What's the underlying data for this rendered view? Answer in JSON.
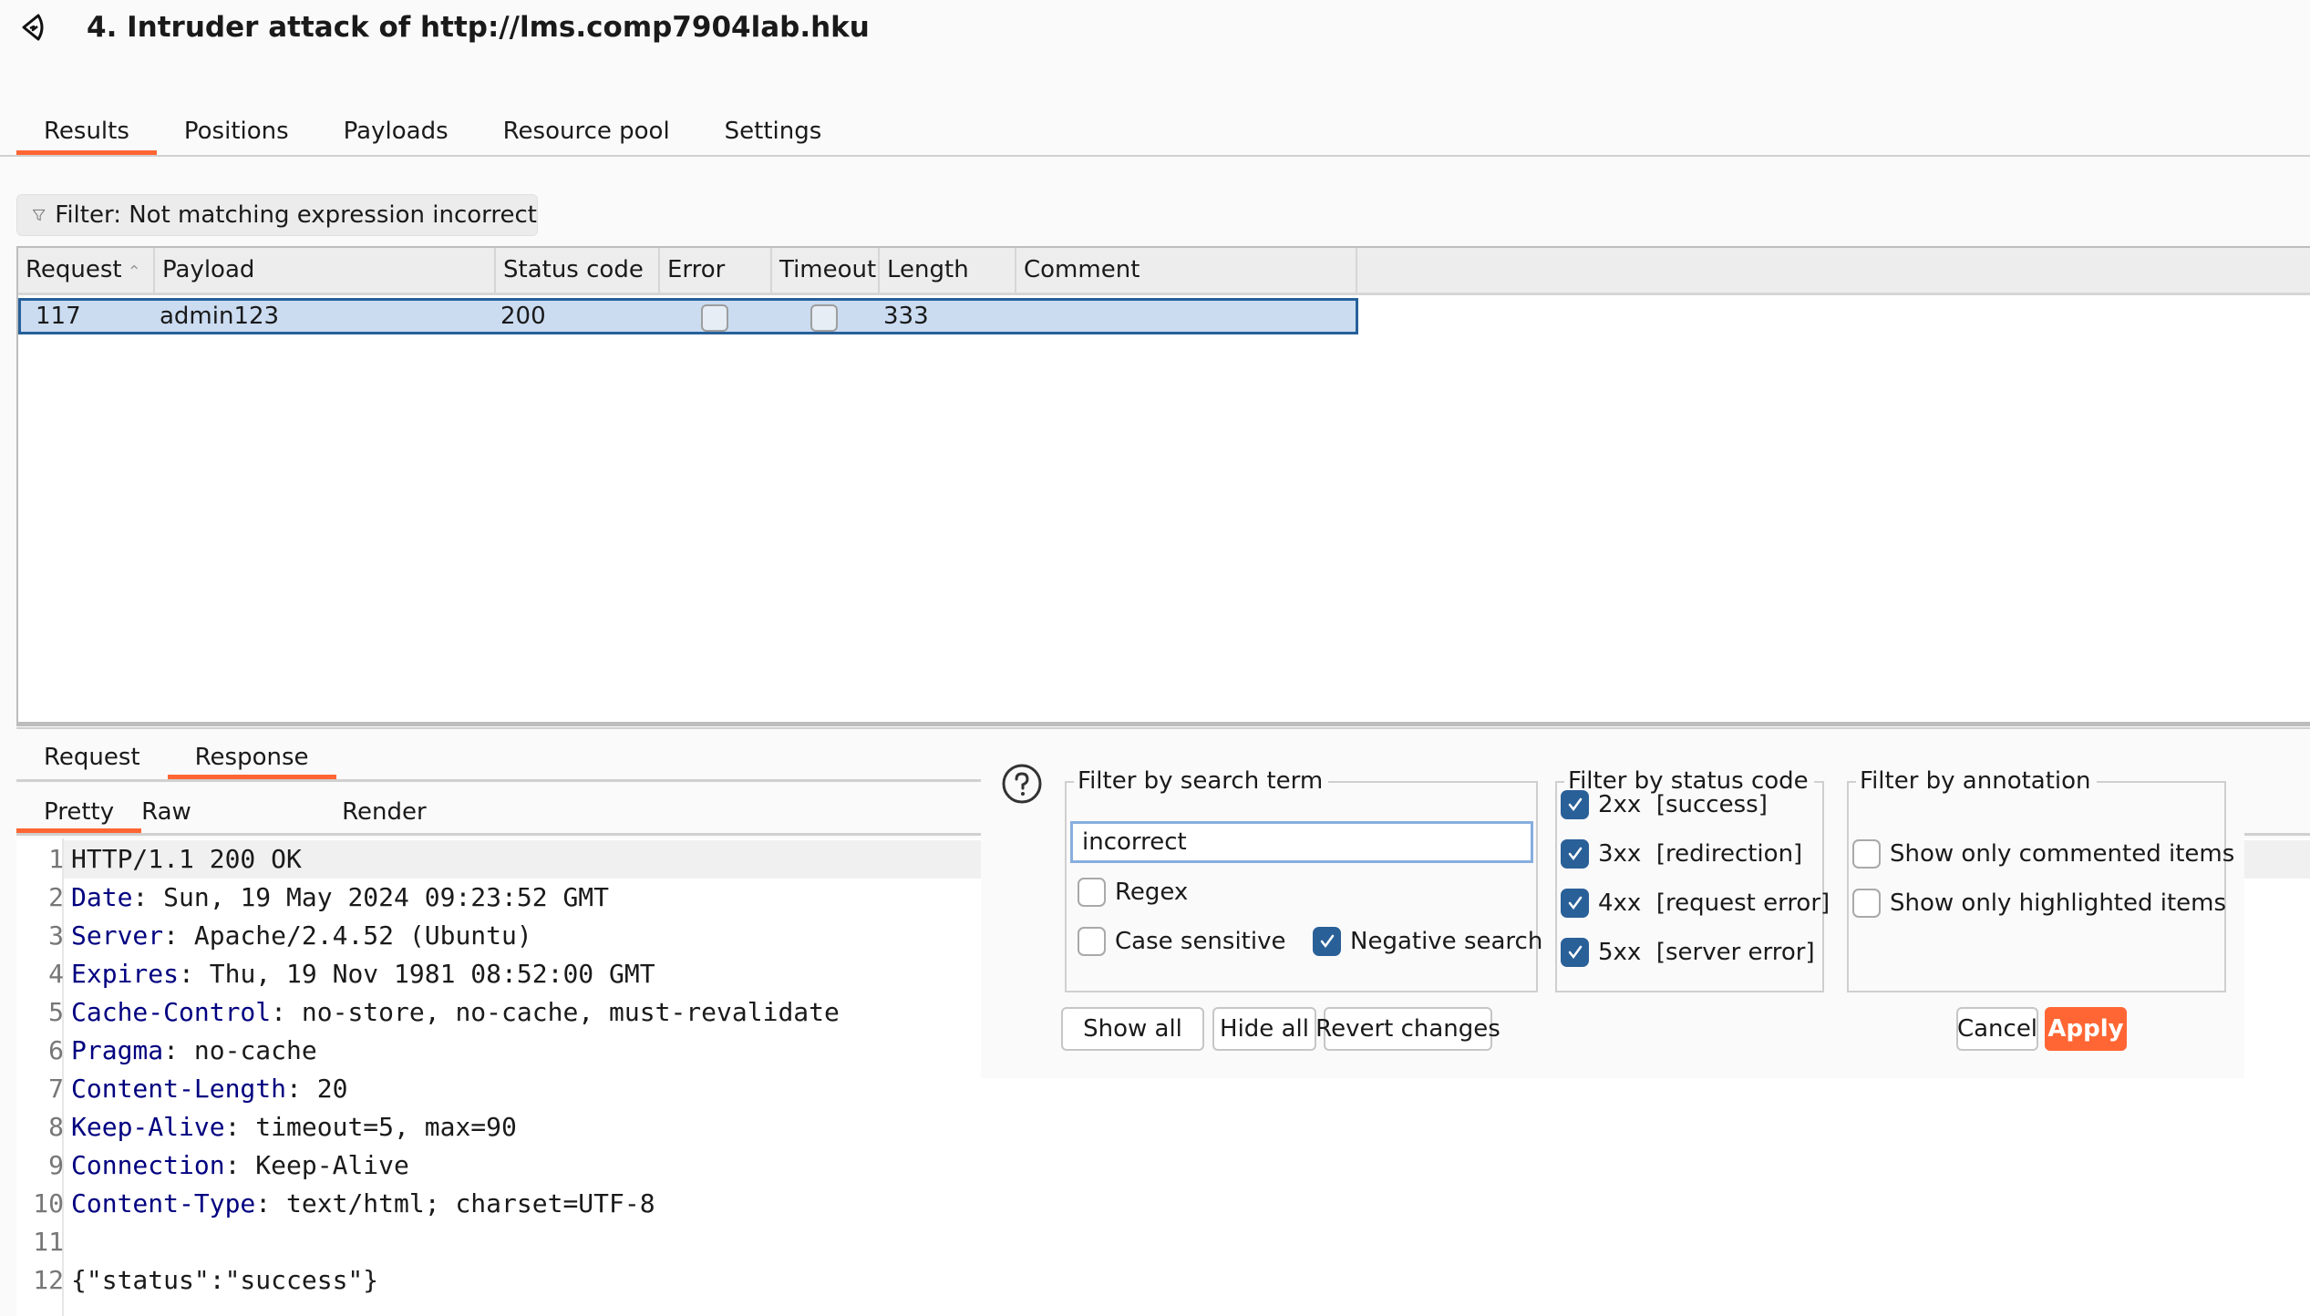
{
  "window": {
    "title": "4. Intruder attack of http://lms.comp7904lab.hku",
    "icon": "burp-intruder-icon"
  },
  "main_tabs": [
    {
      "label": "Results",
      "active": true
    },
    {
      "label": "Positions",
      "active": false
    },
    {
      "label": "Payloads",
      "active": false
    },
    {
      "label": "Resource pool",
      "active": false
    },
    {
      "label": "Settings",
      "active": false
    }
  ],
  "filter_chip": {
    "icon": "filter-icon",
    "label": "Filter: Not matching expression incorrect"
  },
  "results_table": {
    "columns": [
      "Request",
      "Payload",
      "Status code",
      "Error",
      "Timeout",
      "Length",
      "Comment"
    ],
    "sort_column": "Request",
    "sort_direction": "ascending",
    "rows": [
      {
        "request": "117",
        "payload": "admin123",
        "status_code": "200",
        "error": false,
        "timeout": false,
        "length": "333",
        "comment": "",
        "selected": true
      }
    ]
  },
  "message_tabs": [
    {
      "label": "Request",
      "active": false
    },
    {
      "label": "Response",
      "active": true
    }
  ],
  "view_tabs": [
    {
      "label": "Pretty",
      "active": true
    },
    {
      "label": "Raw",
      "active": false
    },
    {
      "label": "Render",
      "active": false
    }
  ],
  "response_lines": [
    {
      "n": "1",
      "name": "",
      "sep": "",
      "value": "HTTP/1.1 200 OK"
    },
    {
      "n": "2",
      "name": "Date",
      "sep": ":",
      "value": " Sun, 19 May 2024 09:23:52 GMT"
    },
    {
      "n": "3",
      "name": "Server",
      "sep": ":",
      "value": " Apache/2.4.52 (Ubuntu)"
    },
    {
      "n": "4",
      "name": "Expires",
      "sep": ":",
      "value": " Thu, 19 Nov 1981 08:52:00 GMT"
    },
    {
      "n": "5",
      "name": "Cache-Control",
      "sep": ":",
      "value": " no-store, no-cache, must-revalidate"
    },
    {
      "n": "6",
      "name": "Pragma",
      "sep": ":",
      "value": " no-cache"
    },
    {
      "n": "7",
      "name": "Content-Length",
      "sep": ":",
      "value": " 20"
    },
    {
      "n": "8",
      "name": "Keep-Alive",
      "sep": ":",
      "value": " timeout=5, max=90"
    },
    {
      "n": "9",
      "name": "Connection",
      "sep": ":",
      "value": " Keep-Alive"
    },
    {
      "n": "10",
      "name": "Content-Type",
      "sep": ":",
      "value": " text/html; charset=UTF-8"
    },
    {
      "n": "11",
      "name": "",
      "sep": "",
      "value": ""
    },
    {
      "n": "12",
      "name": "",
      "sep": "",
      "value": "{\"status\":\"success\"}"
    }
  ],
  "filter_dialog": {
    "help_icon": "help-icon",
    "search_group": {
      "title": "Filter by search term",
      "search_value": "incorrect",
      "regex_label": "Regex",
      "regex_checked": false,
      "case_label": "Case sensitive",
      "case_checked": false,
      "negative_label": "Negative search",
      "negative_checked": true
    },
    "status_group": {
      "title": "Filter by status code",
      "items": [
        {
          "label": "2xx  [success]",
          "checked": true
        },
        {
          "label": "3xx  [redirection]",
          "checked": true
        },
        {
          "label": "4xx  [request error]",
          "checked": true
        },
        {
          "label": "5xx  [server error]",
          "checked": true
        }
      ]
    },
    "annotation_group": {
      "title": "Filter by annotation",
      "items": [
        {
          "label": "Show only commented items",
          "checked": false
        },
        {
          "label": "Show only highlighted items",
          "checked": false
        }
      ]
    },
    "buttons": {
      "show_all": "Show all",
      "hide_all": "Hide all",
      "revert": "Revert changes",
      "cancel": "Cancel",
      "apply": "Apply"
    }
  },
  "colors": {
    "accent": "#ff6633",
    "selection_bg": "#cbdcf1",
    "selection_border": "#26609a",
    "checkbox_checked": "#2a6098",
    "header_name": "#000080"
  }
}
